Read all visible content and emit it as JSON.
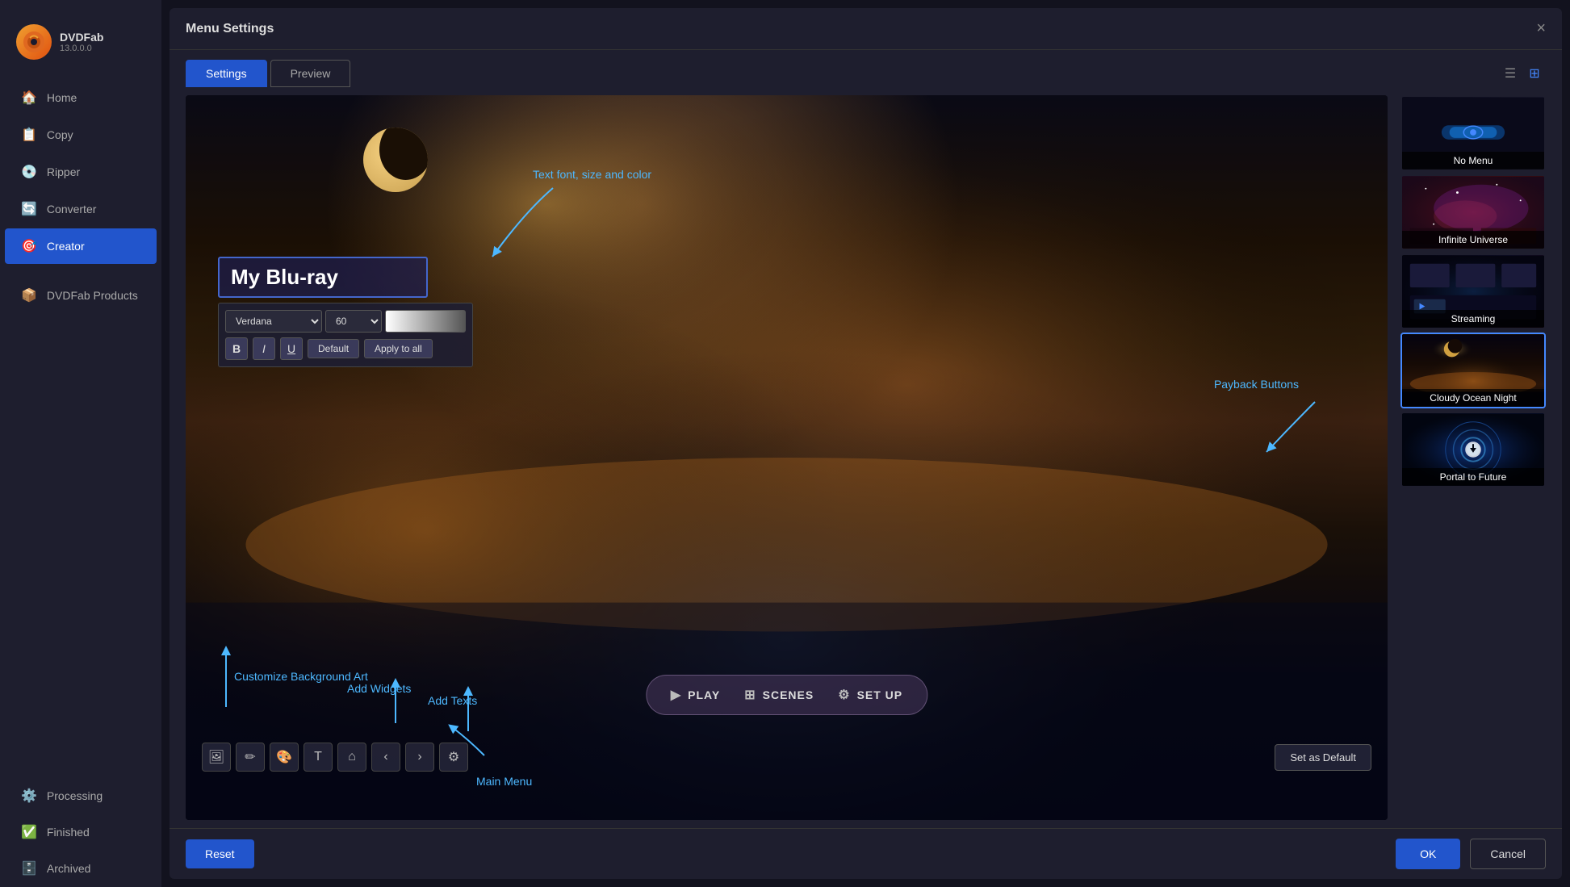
{
  "app": {
    "name": "DVDFab",
    "version": "13.0.0.0"
  },
  "sidebar": {
    "items": [
      {
        "id": "home",
        "label": "Home",
        "icon": "🏠",
        "active": false
      },
      {
        "id": "copy",
        "label": "Copy",
        "icon": "📋",
        "active": false
      },
      {
        "id": "ripper",
        "label": "Ripper",
        "icon": "💿",
        "active": false
      },
      {
        "id": "converter",
        "label": "Converter",
        "icon": "🔄",
        "active": false
      },
      {
        "id": "creator",
        "label": "Creator",
        "icon": "🎯",
        "active": true
      },
      {
        "id": "dvdfab-products",
        "label": "DVDFab Products",
        "icon": "📦",
        "active": false
      },
      {
        "id": "processing",
        "label": "Processing",
        "icon": "⚙️",
        "active": false
      },
      {
        "id": "finished",
        "label": "Finished",
        "icon": "✅",
        "active": false
      },
      {
        "id": "archived",
        "label": "Archived",
        "icon": "🗄️",
        "active": false
      }
    ]
  },
  "modal": {
    "title": "Menu Settings",
    "tabs": [
      {
        "id": "settings",
        "label": "Settings",
        "active": true
      },
      {
        "id": "preview",
        "label": "Preview",
        "active": false
      }
    ],
    "close_label": "×"
  },
  "editor": {
    "title_text": "My Blu-ray",
    "font": "Verdana",
    "size": "60",
    "buttons": {
      "bold": "B",
      "italic": "I",
      "underline": "U",
      "default": "Default",
      "apply_all": "Apply to all"
    }
  },
  "annotations": {
    "font_label": "Text font, size and color",
    "customize_bg": "Customize Background Art",
    "add_widgets": "Add Widgets",
    "add_texts": "Add Texts",
    "main_menu": "Main Menu",
    "payback_buttons": "Payback Buttons"
  },
  "playback": {
    "play_label": "PLAY",
    "scenes_label": "SCENES",
    "setup_label": "SET UP"
  },
  "toolbar": {
    "set_default_label": "Set as Default"
  },
  "footer": {
    "reset_label": "Reset",
    "ok_label": "OK",
    "cancel_label": "Cancel"
  },
  "themes": [
    {
      "id": "no-menu",
      "label": "No Menu",
      "selected": false,
      "type": "no-menu"
    },
    {
      "id": "infinite-universe",
      "label": "Infinite Universe",
      "selected": false,
      "type": "infinite"
    },
    {
      "id": "streaming",
      "label": "Streaming",
      "selected": false,
      "type": "streaming"
    },
    {
      "id": "cloudy-ocean-night",
      "label": "Cloudy Ocean Night",
      "selected": true,
      "type": "cloudy"
    },
    {
      "id": "portal-to-future",
      "label": "Portal to Future",
      "selected": false,
      "type": "portal"
    }
  ],
  "top_bar": {
    "close": "✕"
  }
}
